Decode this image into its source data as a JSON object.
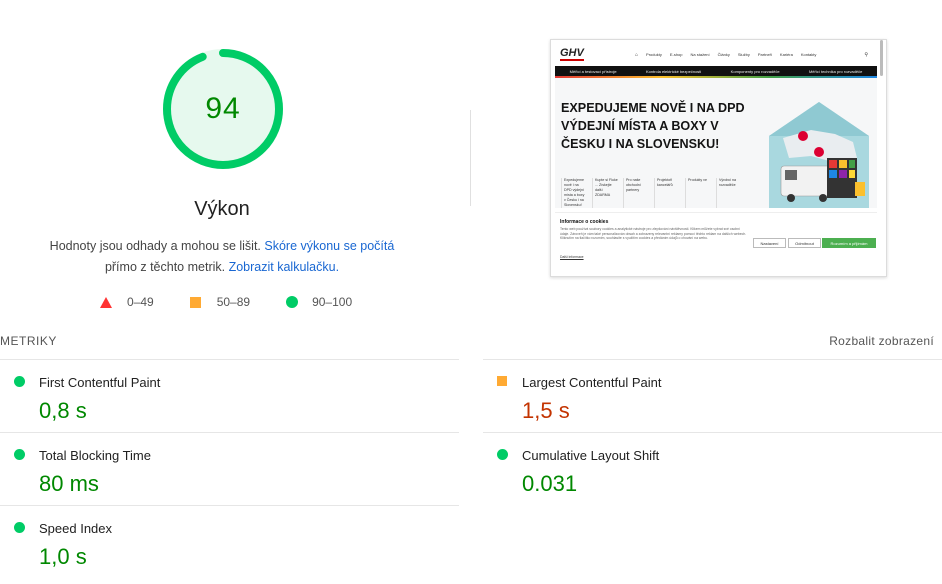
{
  "score": {
    "value": "94",
    "fraction": 0.94,
    "title": "Výkon",
    "color": "#00cc66"
  },
  "summary": {
    "text1": "Hodnoty jsou odhady a mohou se lišit. ",
    "link1": "Skóre výkonu se počítá",
    "text2": " přímo z těchto metrik. ",
    "link2": "Zobrazit kalkulačku."
  },
  "legend": [
    {
      "icon": "triangle-icon",
      "label": "0–49",
      "color": "#ff3333"
    },
    {
      "icon": "square-icon",
      "label": "50–89",
      "color": "#ffaa33"
    },
    {
      "icon": "circle-icon",
      "label": "90–100",
      "color": "#00cc66"
    }
  ],
  "screenshot": {
    "logo": "GHV",
    "menu": [
      "Produkty",
      "E-shop",
      "Na stažení",
      "Články",
      "Služby",
      "Partneři",
      "Kariéra",
      "Kontakty"
    ],
    "bar_items": [
      "Měřicí a testovací přístroje",
      "Kontrola elektrické bezpečnosti",
      "Komponenty pro rozvaděče",
      "Měřicí technika pro rozvaděče"
    ],
    "headline": "EXPEDUJEME NOVĚ I NA DPD VÝDEJNÍ MÍSTA A BOXY V ČESKU I NA SLOVENSKU!",
    "links": [
      "Expedujeme nově i na DPD výdejní místa a boxy v Česku i na Slovensku!",
      "Kupte si Fluke ... Získejte další ZDARMA",
      "Pro naše obchodní partnery",
      "Projektoři kancelářů",
      "Produkty ve",
      "Výrobci na rozvaděče"
    ],
    "cookie_title": "Informace o cookies",
    "cookie_text": "Tento web používá soubory cookies a analytické nástroje pro zlepšování návštěvnosti. Klikem můžete vybrat své osobní údaje. Zároveň je vám také personalizován obsah a zobrazeny relevantní reklamy pomocí těchto reklam na dalších webech. Kliknutím na tlačítko rozumím, souhlasíte s využitím cookies a předáním údajů o chování na webu.",
    "cookie_link": "Další informace",
    "btn_settings": "Nastavení",
    "btn_reject": "Odmítnout",
    "btn_accept": "Rozumím a přijímám"
  },
  "metrics_header": {
    "label": "METRIKY",
    "expand": "Rozbalit zobrazení"
  },
  "metrics": [
    {
      "name": "First Contentful Paint",
      "value": "0,8 s",
      "rating": "good"
    },
    {
      "name": "Largest Contentful Paint",
      "value": "1,5 s",
      "rating": "average"
    },
    {
      "name": "Total Blocking Time",
      "value": "80 ms",
      "rating": "good"
    },
    {
      "name": "Cumulative Layout Shift",
      "value": "0.031",
      "rating": "good"
    },
    {
      "name": "Speed Index",
      "value": "1,0 s",
      "rating": "good"
    }
  ],
  "colors": {
    "pass": "#008800",
    "average": "#c33300",
    "link": "#1967d2"
  }
}
